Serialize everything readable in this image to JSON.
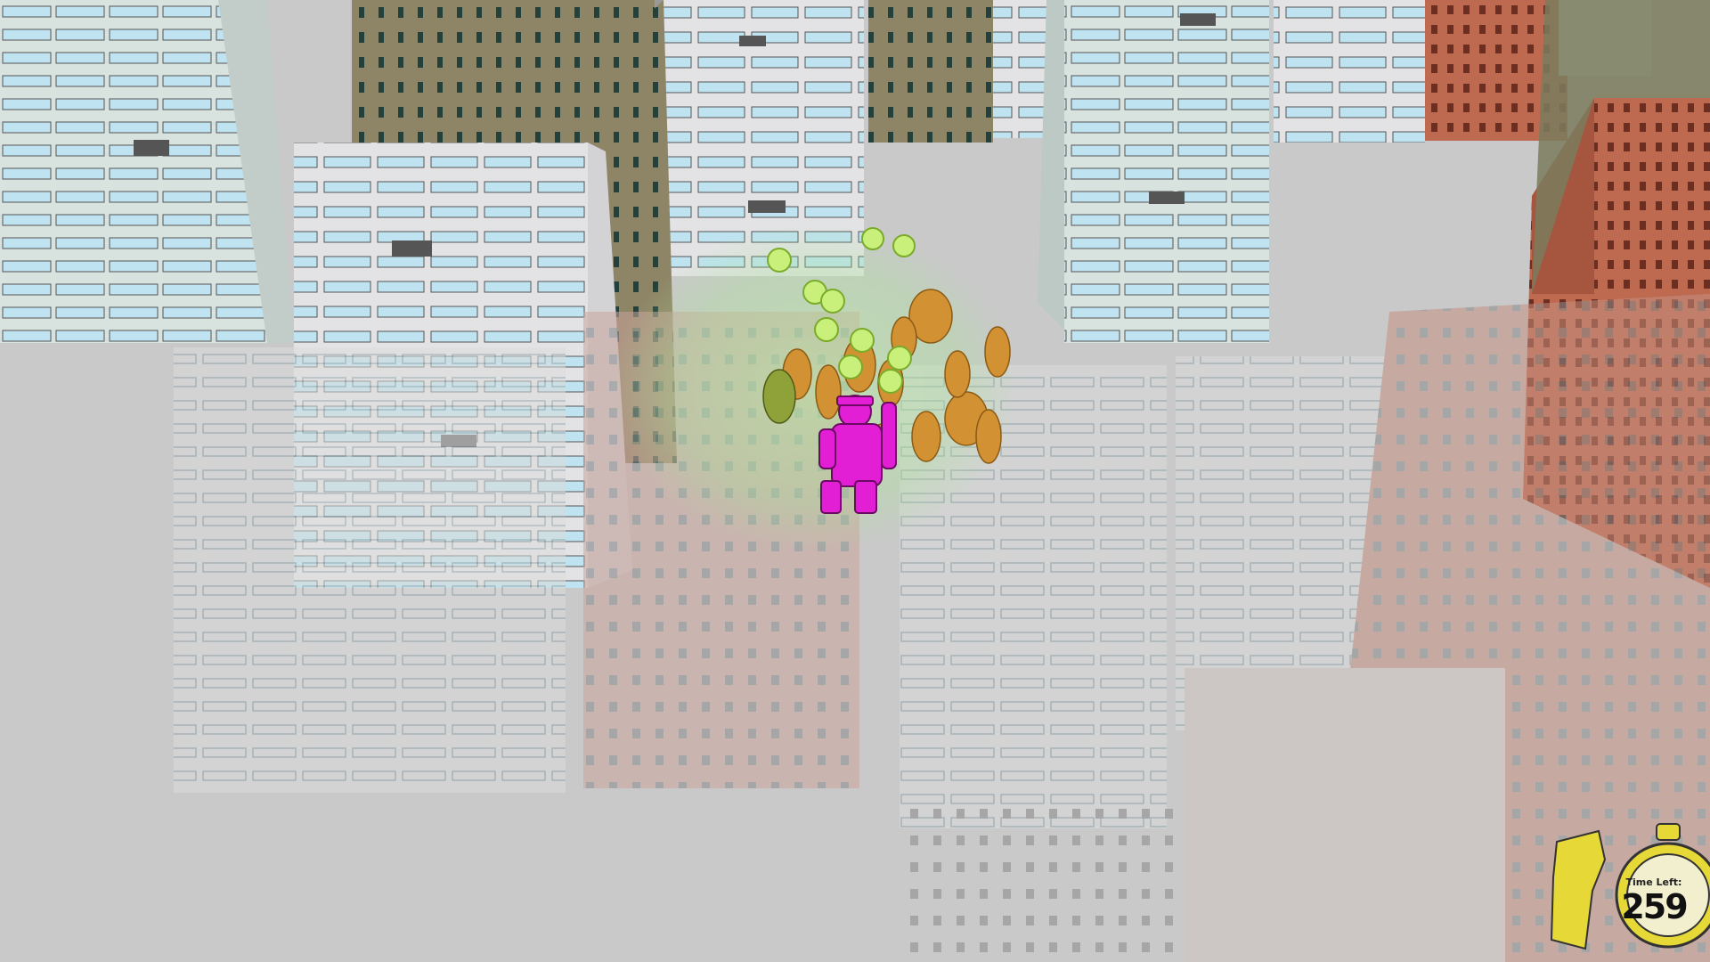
{
  "hud": {
    "timer_label": "Time Left:",
    "timer_value": "259"
  },
  "colors": {
    "ground": "#c9c9c9",
    "building_white": "#e3e3e5",
    "building_mint": "#d8e2de",
    "building_brown": "#8e8466",
    "building_terracotta": "#bd6a51",
    "window_blue": "#bfe3f0",
    "player": "#e21fd4",
    "crowd": "#d29234",
    "laugh_emote": "#b8e86a",
    "timer_gold": "#e6d836"
  },
  "icons": {
    "player": "pirate-character-icon",
    "crowd": "crowd-people-icon",
    "emote": "laughing-face-icon",
    "timer": "stopwatch-icon"
  }
}
